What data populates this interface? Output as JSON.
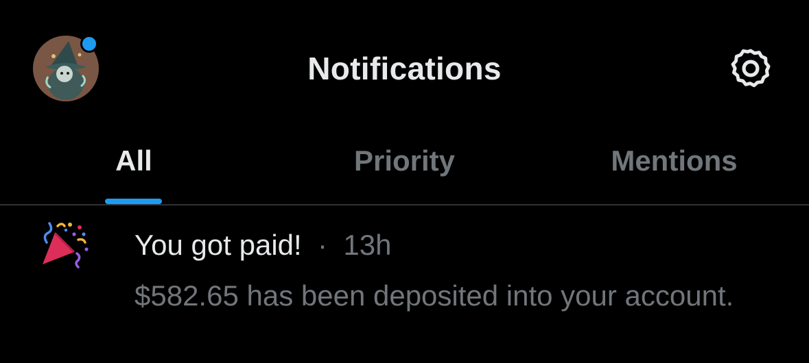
{
  "header": {
    "title": "Notifications",
    "avatar_icon": "wizard-avatar",
    "settings_icon": "gear-icon",
    "unread_dot_color": "#1d9bf0"
  },
  "tabs": [
    {
      "label": "All",
      "active": true
    },
    {
      "label": "Priority",
      "active": false
    },
    {
      "label": "Mentions",
      "active": false
    }
  ],
  "notifications": [
    {
      "icon": "party-popper-icon",
      "title": "You got paid!",
      "separator": "·",
      "time": "13h",
      "body": "$582.65 has been deposited into your account."
    }
  ],
  "colors": {
    "background": "#000000",
    "accent": "#1d9bf0",
    "primary_text": "#e7e9ea",
    "secondary_text": "#71767b",
    "divider": "#2f3336"
  }
}
